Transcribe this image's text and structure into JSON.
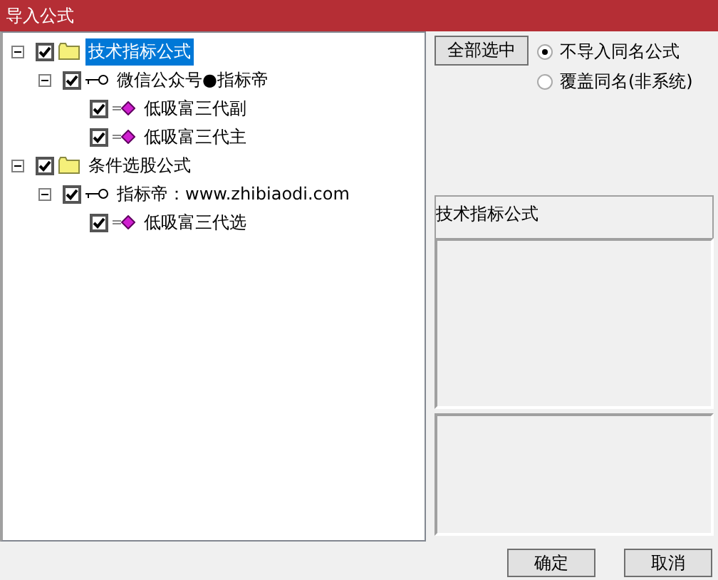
{
  "window": {
    "title": "导入公式"
  },
  "tree": [
    {
      "kind": "folder",
      "label": "技术指标公式",
      "checked": true,
      "selected": true,
      "expanded": true,
      "children": [
        {
          "kind": "group",
          "label": "微信公众号●指标帝",
          "checked": true,
          "selected": false,
          "expanded": true,
          "children": [
            {
              "kind": "formula",
              "label": "低吸富三代副",
              "checked": true,
              "selected": false
            },
            {
              "kind": "formula",
              "label": "低吸富三代主",
              "checked": true,
              "selected": false
            }
          ]
        }
      ]
    },
    {
      "kind": "folder",
      "label": "条件选股公式",
      "checked": true,
      "selected": false,
      "expanded": true,
      "children": [
        {
          "kind": "group",
          "label": "指标帝：www.zhibiaodi.com",
          "checked": true,
          "selected": false,
          "expanded": true,
          "children": [
            {
              "kind": "formula",
              "label": "低吸富三代选",
              "checked": true,
              "selected": false
            }
          ]
        }
      ]
    }
  ],
  "select_all_button": "全部选中",
  "options": [
    {
      "label": "不导入同名公式",
      "selected": true
    },
    {
      "label": "覆盖同名(非系统)",
      "selected": false
    }
  ],
  "info_label": "技术指标公式",
  "buttons": [
    "确定",
    "取消"
  ]
}
